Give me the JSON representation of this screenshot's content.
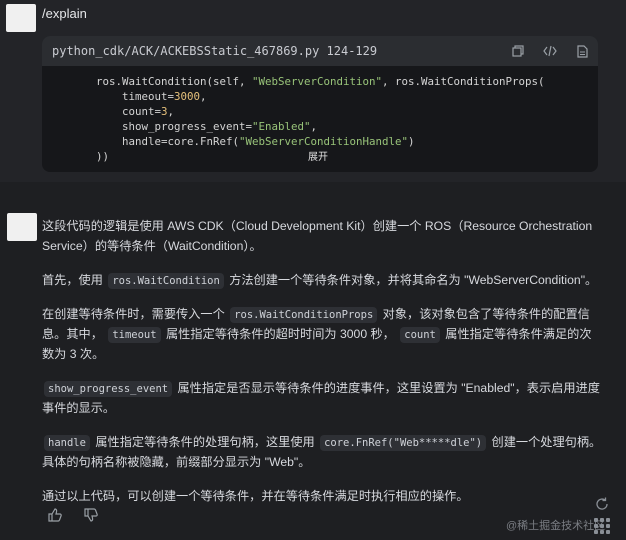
{
  "user": {
    "command": "/explain",
    "file_ref": "python_cdk/ACK/ACKEBSStatic_467869.py 124-129",
    "code_lines": [
      "ros.WaitCondition(self, \"WebServerCondition\", ros.WaitConditionProps(",
      "    timeout=3000,",
      "    count=3,",
      "    show_progress_event=\"Enabled\",",
      "    handle=core.FnRef(\"WebServerConditionHandle\")",
      "))"
    ],
    "expand_label": "展开"
  },
  "answer": {
    "p1": "这段代码的逻辑是使用 AWS CDK（Cloud Development Kit）创建一个 ROS（Resource Orchestration Service）的等待条件（WaitCondition）。",
    "p2_pre": "首先，使用",
    "p2_code": "ros.WaitCondition",
    "p2_post": "方法创建一个等待条件对象，并将其命名为 \"WebServerCondition\"。",
    "p3_a": "在创建等待条件时，需要传入一个",
    "p3_code1": "ros.WaitConditionProps",
    "p3_b": "对象，该对象包含了等待条件的配置信息。其中，",
    "p3_code2": "timeout",
    "p3_c": "属性指定等待条件的超时时间为 3000 秒，",
    "p3_code3": "count",
    "p3_d": "属性指定等待条件满足的次数为 3 次。",
    "p4_code": "show_progress_event",
    "p4_text": "属性指定是否显示等待条件的进度事件，这里设置为 \"Enabled\"，表示启用进度事件的显示。",
    "p5_code1": "handle",
    "p5_a": "属性指定等待条件的处理句柄，这里使用",
    "p5_code2": "core.FnRef(\"Web*****dle\")",
    "p5_b": "创建一个处理句柄。具体的句柄名称被隐藏，前缀部分显示为 \"Web\"。",
    "p6": "通过以上代码，可以创建一个等待条件，并在等待条件满足时执行相应的操作。"
  },
  "watermark": "@稀土掘金技术社区",
  "icons": [
    "copy-icon",
    "code-icon",
    "insert-file-icon",
    "thumbs-up-icon",
    "thumbs-down-icon",
    "refresh-icon",
    "grid-icon"
  ]
}
